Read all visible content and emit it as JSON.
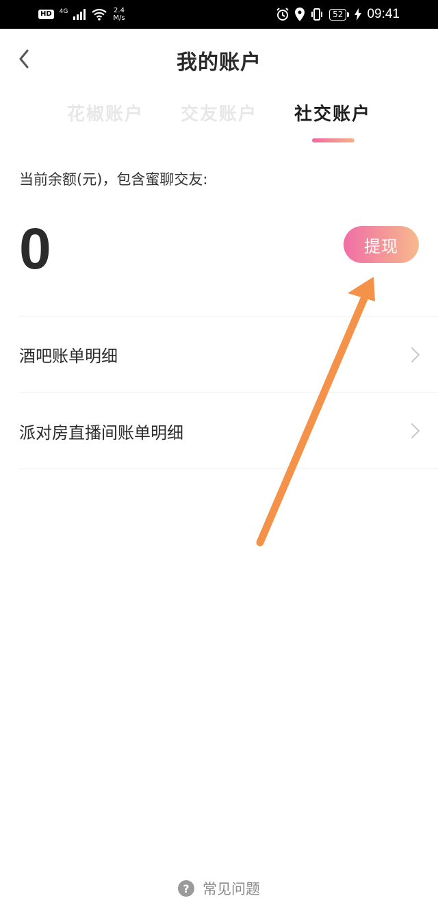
{
  "status_bar": {
    "hd": "HD",
    "network": "4G",
    "speed_value": "2.4",
    "speed_unit": "M/s",
    "battery": "52",
    "time": "09:41",
    "icons": [
      "signal-icon",
      "wifi-icon",
      "alarm-icon",
      "location-icon",
      "vibrate-icon",
      "battery-icon",
      "charging-icon"
    ]
  },
  "header": {
    "title": "我的账户",
    "back_icon": "chevron-left-icon"
  },
  "tabs": [
    {
      "label": "花椒账户",
      "active": false
    },
    {
      "label": "交友账户",
      "active": false
    },
    {
      "label": "社交账户",
      "active": true
    }
  ],
  "balance": {
    "label": "当前余额(元)，包含蜜聊交友:",
    "value": "0",
    "withdraw_label": "提现"
  },
  "list": [
    {
      "label": "酒吧账单明细",
      "icon": "chevron-right-icon"
    },
    {
      "label": "派对房直播间账单明细",
      "icon": "chevron-right-icon"
    }
  ],
  "faq": {
    "icon_glyph": "?",
    "label": "常见问题"
  },
  "colors": {
    "accent_start": "#f06ea6",
    "accent_end": "#f7b98c",
    "annotation_arrow": "#f5924a"
  }
}
